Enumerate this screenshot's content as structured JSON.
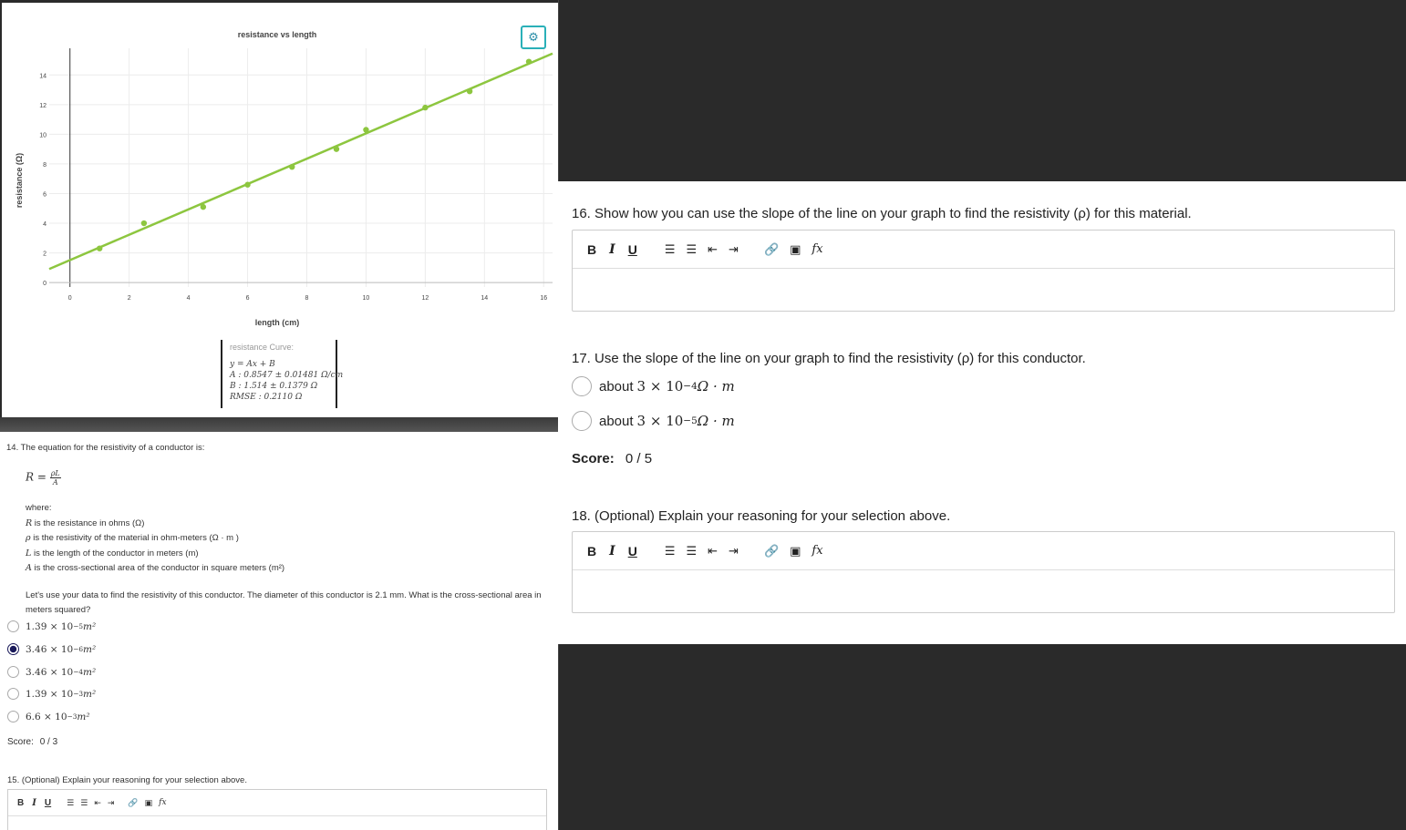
{
  "chart": {
    "title": "resistance vs length",
    "xlabel": "length (cm)",
    "ylabel": "resistance (Ω)",
    "xticks": [
      "0",
      "2",
      "4",
      "6",
      "8",
      "10",
      "12",
      "14",
      "16"
    ],
    "yticks": [
      "0",
      "2",
      "4",
      "6",
      "8",
      "10",
      "12",
      "14"
    ],
    "gear_icon": "gear-icon",
    "fit": {
      "title": "resistance Curve:",
      "equation": "y = Ax + B",
      "A": "A : 0.8547 ± 0.01481 Ω/cm",
      "B": "B : 1.514 ± 0.1379 Ω",
      "RMSE": "RMSE : 0.2110 Ω"
    }
  },
  "chart_data": {
    "type": "scatter",
    "title": "resistance vs length",
    "xlabel": "length (cm)",
    "ylabel": "resistance (Ω)",
    "xlim": [
      -0.7,
      16.3
    ],
    "ylim": [
      -0.3,
      15.8
    ],
    "points": [
      {
        "x": 1.0,
        "y": 2.3
      },
      {
        "x": 2.5,
        "y": 4.0
      },
      {
        "x": 4.5,
        "y": 5.1
      },
      {
        "x": 6.0,
        "y": 6.6
      },
      {
        "x": 7.5,
        "y": 7.8
      },
      {
        "x": 9.0,
        "y": 9.0
      },
      {
        "x": 10.0,
        "y": 10.3
      },
      {
        "x": 12.0,
        "y": 11.8
      },
      {
        "x": 13.5,
        "y": 12.9
      },
      {
        "x": 15.5,
        "y": 14.9
      }
    ],
    "fit_line": {
      "slope": 0.8547,
      "intercept": 1.514
    },
    "color": "#8dc63f",
    "grid": true
  },
  "q14": {
    "title": "14.  The equation for the resistivity of a conductor is:",
    "formula_lhs": "R = ",
    "formula_num": "ρL",
    "formula_den": "A",
    "where": "where:",
    "defs": [
      {
        "sym": "R",
        "text": " is the resistance in ohms (Ω)"
      },
      {
        "sym": "ρ",
        "text": " is the resistivity of the material in ohm-meters (Ω · m )"
      },
      {
        "sym": "L",
        "text": " is the length of the conductor in meters (m)"
      },
      {
        "sym": "A",
        "text": " is the cross-sectional area of the conductor in square meters (m²)"
      }
    ],
    "prompt": "Let's use your data to find the resistivity of this conductor. The diameter of this conductor is 2.1 mm. What is the cross-sectional area in meters squared?",
    "options": [
      {
        "mant": "1.39 × 10",
        "exp": "−5",
        "unit": " m²",
        "checked": false
      },
      {
        "mant": "3.46 × 10",
        "exp": "−6",
        "unit": " m²",
        "checked": true
      },
      {
        "mant": "3.46 × 10",
        "exp": "−4",
        "unit": " m²",
        "checked": false
      },
      {
        "mant": "1.39 × 10",
        "exp": "−3",
        "unit": " m²",
        "checked": false
      },
      {
        "mant": "6.6 × 10",
        "exp": "−3",
        "unit": " m²",
        "checked": false
      }
    ],
    "score_label": "Score:",
    "score_value": "0 / 3"
  },
  "q15": {
    "title": "15.  (Optional) Explain your reasoning for your selection above."
  },
  "toolbar": {
    "bold": "B",
    "italic": "I",
    "underline": "U",
    "ordered_list_icon": "ordered-list-icon",
    "bullet_list_icon": "bullet-list-icon",
    "outdent_icon": "outdent-icon",
    "indent_icon": "indent-icon",
    "link_icon": "link-icon",
    "image_icon": "image-icon",
    "formula": "fx"
  },
  "q16": {
    "title": "16.  Show how you can use the slope of the line on your graph to find the resistivity (ρ) for this material."
  },
  "q17": {
    "title": "17.  Use the slope of the line on your graph to find the resistivity (ρ) for this conductor.",
    "options": [
      {
        "prefix": "about ",
        "mant": "3 × 10",
        "exp": "−4",
        "unit": " Ω · m"
      },
      {
        "prefix": "about ",
        "mant": "3 × 10",
        "exp": "−5",
        "unit": " Ω · m"
      }
    ],
    "score_label": "Score:",
    "score_value": "0 / 5"
  },
  "q18": {
    "title": "18.  (Optional) Explain your reasoning for your selection above."
  }
}
